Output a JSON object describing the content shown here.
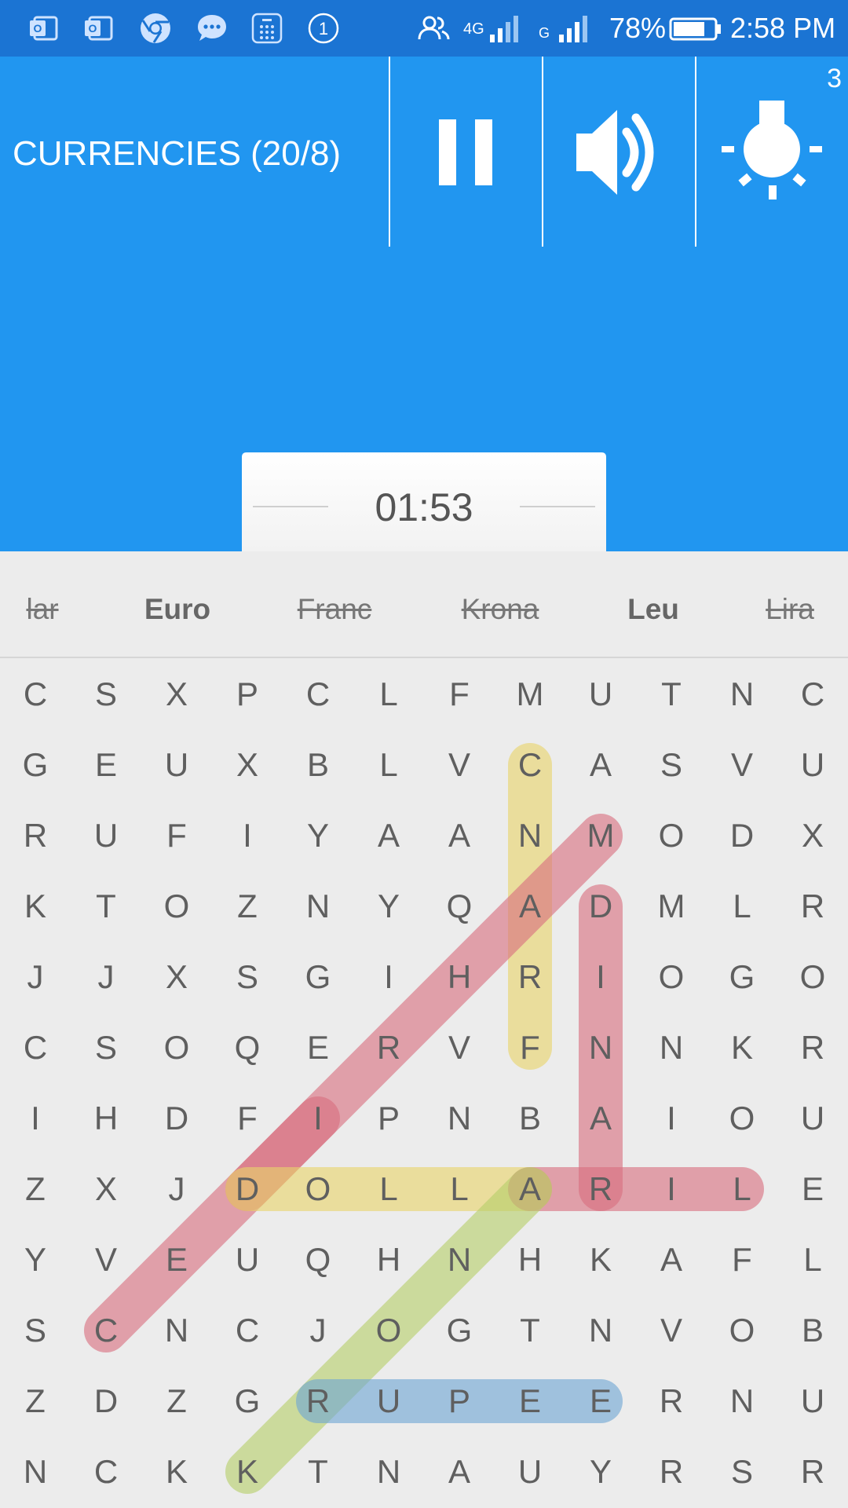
{
  "status_bar": {
    "network_label": "4G",
    "battery_percent": "78%",
    "time": "2:58 PM",
    "notification_count": "1",
    "battery_level": 0.78
  },
  "header": {
    "title": "CURRENCIES (20/8)",
    "hint_count": "3",
    "pause_icon": "pause-icon",
    "sound_icon": "volume-icon",
    "hint_icon": "lightbulb-icon"
  },
  "timer": {
    "value": "01:53"
  },
  "words": [
    {
      "label": "lar",
      "state": "found"
    },
    {
      "label": "Euro",
      "state": "active"
    },
    {
      "label": "Franc",
      "state": "found"
    },
    {
      "label": "Krona",
      "state": "found"
    },
    {
      "label": "Leu",
      "state": "active"
    },
    {
      "label": "Lira",
      "state": "found"
    }
  ],
  "grid": {
    "rows": [
      [
        "C",
        "S",
        "X",
        "P",
        "C",
        "L",
        "F",
        "M",
        "U",
        "T",
        "N",
        "C"
      ],
      [
        "G",
        "E",
        "U",
        "X",
        "B",
        "L",
        "V",
        "C",
        "A",
        "S",
        "V",
        "U"
      ],
      [
        "R",
        "U",
        "F",
        "I",
        "Y",
        "A",
        "A",
        "N",
        "M",
        "O",
        "D",
        "X"
      ],
      [
        "K",
        "T",
        "O",
        "Z",
        "N",
        "Y",
        "Q",
        "A",
        "D",
        "M",
        "L",
        "R"
      ],
      [
        "J",
        "J",
        "X",
        "S",
        "G",
        "I",
        "H",
        "R",
        "I",
        "O",
        "G",
        "O"
      ],
      [
        "C",
        "S",
        "O",
        "Q",
        "E",
        "R",
        "V",
        "F",
        "N",
        "N",
        "K",
        "R"
      ],
      [
        "I",
        "H",
        "D",
        "F",
        "I",
        "P",
        "N",
        "B",
        "A",
        "I",
        "O",
        "U"
      ],
      [
        "Z",
        "X",
        "J",
        "D",
        "O",
        "L",
        "L",
        "A",
        "R",
        "I",
        "L",
        "E"
      ],
      [
        "Y",
        "V",
        "E",
        "U",
        "Q",
        "H",
        "N",
        "H",
        "K",
        "A",
        "F",
        "L"
      ],
      [
        "S",
        "C",
        "N",
        "C",
        "J",
        "O",
        "G",
        "T",
        "N",
        "V",
        "O",
        "B"
      ],
      [
        "Z",
        "D",
        "Z",
        "G",
        "R",
        "U",
        "P",
        "E",
        "E",
        "R",
        "N",
        "U"
      ],
      [
        "N",
        "C",
        "K",
        "K",
        "T",
        "N",
        "A",
        "U",
        "Y",
        "R",
        "S",
        "R"
      ]
    ],
    "found_words": [
      {
        "from": [
          1,
          7
        ],
        "to": [
          5,
          7
        ],
        "color": "#e8d36a"
      },
      {
        "from": [
          9,
          1
        ],
        "to": [
          2,
          8
        ],
        "color": "#d9707f"
      },
      {
        "from": [
          3,
          8
        ],
        "to": [
          7,
          8
        ],
        "color": "#d9707f"
      },
      {
        "from": [
          6,
          4
        ],
        "to": [
          7,
          3
        ],
        "color": "#d9707f"
      },
      {
        "from": [
          7,
          3
        ],
        "to": [
          7,
          7
        ],
        "color": "#e8d36a"
      },
      {
        "from": [
          7,
          7
        ],
        "to": [
          7,
          10
        ],
        "color": "#d9707f"
      },
      {
        "from": [
          11,
          3
        ],
        "to": [
          7,
          7
        ],
        "color": "#b7cf6b"
      },
      {
        "from": [
          10,
          4
        ],
        "to": [
          10,
          8
        ],
        "color": "#6fa6d3"
      }
    ]
  },
  "colors": {
    "status_bar": "#1b74d3",
    "header": "#2196f0",
    "background": "#ececec",
    "letter": "#5f5f5f"
  }
}
